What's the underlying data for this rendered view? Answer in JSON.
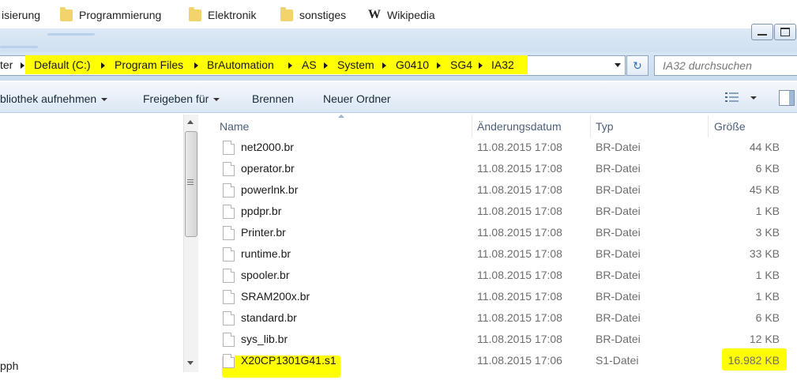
{
  "bookmarks": [
    {
      "label": "isierung",
      "icon": "none"
    },
    {
      "label": "Programmierung",
      "icon": "folder-icon"
    },
    {
      "label": "Elektronik",
      "icon": "folder-icon"
    },
    {
      "label": "sonstiges",
      "icon": "folder-icon"
    },
    {
      "label": "Wikipedia",
      "icon": "wikipedia-icon",
      "glyph": "W"
    }
  ],
  "address": {
    "crumbs": [
      "ter",
      "Default (C:)",
      "Program Files",
      "BrAutomation",
      "AS",
      "System",
      "G0410",
      "SG4",
      "IA32"
    ],
    "refresh_glyph": "↻"
  },
  "search": {
    "placeholder": "IA32 durchsuchen"
  },
  "toolbar": {
    "library": "bliothek aufnehmen",
    "share": "Freigeben für",
    "burn": "Brennen",
    "new_folder": "Neuer Ordner"
  },
  "nav": {
    "partial_item": "pph"
  },
  "columns": {
    "name": "Name",
    "date": "Änderungsdatum",
    "type": "Typ",
    "size": "Größe"
  },
  "files": [
    {
      "name": "net2000.br",
      "date": "11.08.2015 17:08",
      "type": "BR-Datei",
      "size": "44 KB"
    },
    {
      "name": "operator.br",
      "date": "11.08.2015 17:08",
      "type": "BR-Datei",
      "size": "6 KB"
    },
    {
      "name": "powerlnk.br",
      "date": "11.08.2015 17:08",
      "type": "BR-Datei",
      "size": "45 KB"
    },
    {
      "name": "ppdpr.br",
      "date": "11.08.2015 17:08",
      "type": "BR-Datei",
      "size": "1 KB"
    },
    {
      "name": "Printer.br",
      "date": "11.08.2015 17:08",
      "type": "BR-Datei",
      "size": "3 KB"
    },
    {
      "name": "runtime.br",
      "date": "11.08.2015 17:08",
      "type": "BR-Datei",
      "size": "33 KB"
    },
    {
      "name": "spooler.br",
      "date": "11.08.2015 17:08",
      "type": "BR-Datei",
      "size": "1 KB"
    },
    {
      "name": "SRAM200x.br",
      "date": "11.08.2015 17:08",
      "type": "BR-Datei",
      "size": "1 KB"
    },
    {
      "name": "standard.br",
      "date": "11.08.2015 17:08",
      "type": "BR-Datei",
      "size": "6 KB"
    },
    {
      "name": "sys_lib.br",
      "date": "11.08.2015 17:08",
      "type": "BR-Datei",
      "size": "12 KB"
    },
    {
      "name": "X20CP1301G41.s1",
      "date": "11.08.2015 17:06",
      "type": "S1-Datei",
      "size": "16.982 KB"
    }
  ],
  "colors": {
    "highlight": "#ffff00",
    "chrome": "#d7e6f5"
  }
}
